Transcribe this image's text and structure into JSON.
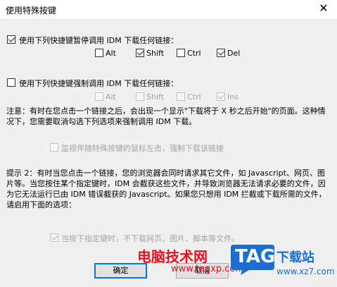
{
  "window": {
    "title": "使用特殊按键",
    "close_icon": "close-icon"
  },
  "group1": {
    "label": "使用下列快捷键暂停调用 IDM 下载任何链接：",
    "checked": true,
    "keys": [
      {
        "label": "Alt",
        "checked": false
      },
      {
        "label": "Shift",
        "checked": true
      },
      {
        "label": "Ctrl",
        "checked": false
      },
      {
        "label": "Del",
        "checked": true
      }
    ]
  },
  "group2": {
    "label": "使用下列快捷键强制调用 IDM 下载任何链接：",
    "checked": false,
    "keys": [
      {
        "label": "Alt",
        "checked": false
      },
      {
        "label": "Shift",
        "checked": false
      },
      {
        "label": "Ctrl",
        "checked": false
      },
      {
        "label": "Ins",
        "checked": true
      }
    ]
  },
  "note1": "注意：有时在您点击一个链接之后，会出现一个显示\"下载将于 X 秒之后开始\"的页面。这种情况下，您需要取消勾选下列选项来强制调用 IDM 下载。",
  "option_monitor": {
    "label": "监视伴随特殊按键的鼠标左击，强制下载该链接",
    "checked": false
  },
  "note2": "提示 2：有时当您点击一个链接，您的浏览器会同时请求其它文件，如 Javascript、网页、图片等。当您按住某个指定键时，IDM 会截获这些文件，并导致浏览器无法请求必要的文件，因为它无法运行已由 IDM 错误截获的 Javascript。如果您只想用 IDM 拦截或下载所需的文件，请启用下面的选项：",
  "option_no_download": {
    "label": "当按下指定键时，不下载网页、图片、脚本等文件。",
    "checked": true
  },
  "buttons": {
    "ok": "确定",
    "cancel": "取消"
  },
  "watermark": {
    "site_name": "电脑技术网",
    "url": "www.tagxp.com",
    "tag": "TAG",
    "brand": "下载站",
    "domain": "www.xz7.com",
    "colors": {
      "red": "#e0141e",
      "blue": "#1c6fd1"
    }
  }
}
